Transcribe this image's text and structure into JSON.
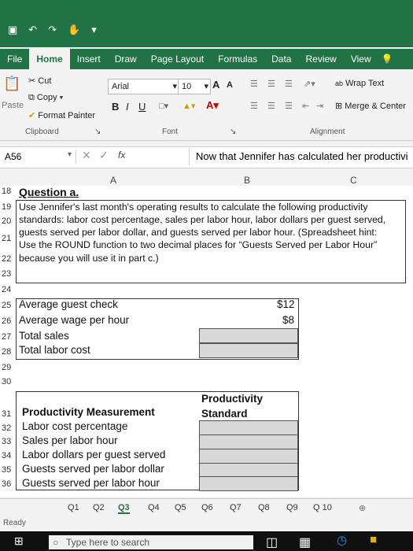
{
  "ribbon": {
    "tabs": [
      "File",
      "Home",
      "Insert",
      "Draw",
      "Page Layout",
      "Formulas",
      "Data",
      "Review",
      "View"
    ],
    "clipboard": {
      "cut": "Cut",
      "copy": "Copy",
      "format_painter": "Format Painter",
      "paste": "Paste",
      "label": "Clipboard"
    },
    "font": {
      "name": "Arial",
      "size": "10",
      "bold": "B",
      "italic": "I",
      "underline": "U",
      "label": "Font",
      "grow": "A",
      "shrink": "A"
    },
    "alignment": {
      "wrap_text": "Wrap Text",
      "merge_center": "Merge & Center",
      "label": "Alignment"
    }
  },
  "formula_bar": {
    "name_box": "A56",
    "fx": "fx",
    "content": "Now that Jennifer has calculated her productivi"
  },
  "columns": [
    "A",
    "B",
    "C"
  ],
  "rows": {
    "r18": {
      "num": "18",
      "text": "Question a."
    },
    "r19": {
      "num": "19",
      "text": "Use Jennifer's last month's operating results to calculate the following productivity"
    },
    "r20": {
      "num": "20",
      "text": "standards: labor cost percentage, sales per labor hour, labor dollars per guest served,"
    },
    "r21": {
      "num": "21",
      "text": "guests served per labor dollar, and guests served per labor hour. (Spreadsheet hint:"
    },
    "r21b": {
      "text": "Use the ROUND function to two decimal places for “Guests Served per Labor Hour”"
    },
    "r22": {
      "num": "22",
      "text": "because you will use it in part c.)"
    },
    "r23": {
      "num": "23"
    },
    "r24": {
      "num": "24"
    },
    "r25": {
      "num": "25",
      "label": "Average guest check",
      "value": "$12"
    },
    "r26": {
      "num": "26",
      "label": "Average wage per hour",
      "value": "$8"
    },
    "r27": {
      "num": "27",
      "label": "Total sales"
    },
    "r28": {
      "num": "28",
      "label": "Total labor cost"
    },
    "r29": {
      "num": "29"
    },
    "r30": {
      "num": "30"
    },
    "r31": {
      "num": "31",
      "label": "Productivity Measurement",
      "header_b1": "Productivity",
      "header_b2": "Standard"
    },
    "r32": {
      "num": "32",
      "label": "Labor cost percentage"
    },
    "r33": {
      "num": "33",
      "label": "Sales per labor hour"
    },
    "r34": {
      "num": "34",
      "label": "Labor dollars per guest served"
    },
    "r35": {
      "num": "35",
      "label": "Guests served per labor dollar"
    },
    "r36": {
      "num": "36",
      "label": "Guests served per labor hour"
    }
  },
  "sheet_tabs": [
    "Q1",
    "Q2",
    "Q3",
    "Q4",
    "Q5",
    "Q6",
    "Q7",
    "Q8",
    "Q9",
    "Q 10"
  ],
  "status": {
    "text": "Ready"
  },
  "taskbar": {
    "search_placeholder": "Type here to search"
  },
  "colors": {
    "excel_green": "#217346",
    "shaded_cell": "#d9d9d9"
  }
}
